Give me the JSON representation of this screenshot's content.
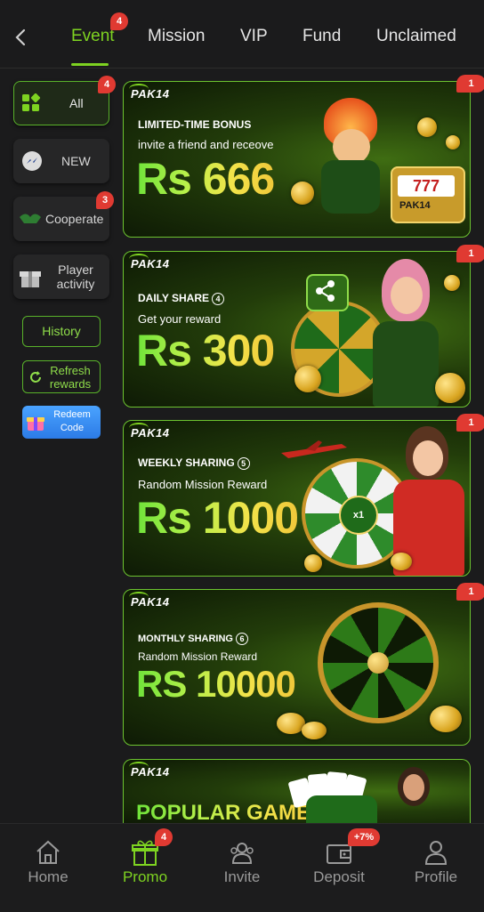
{
  "tabs": {
    "items": [
      {
        "label": "Event",
        "badge": "4"
      },
      {
        "label": "Mission"
      },
      {
        "label": "VIP"
      },
      {
        "label": "Fund"
      },
      {
        "label": "Unclaimed"
      }
    ]
  },
  "sidebar": {
    "all": {
      "label": "All",
      "badge": "4"
    },
    "new": {
      "label": "NEW"
    },
    "cooperate": {
      "label": "Cooperate",
      "badge": "3"
    },
    "player_activity": {
      "line1": "Player",
      "line2": "activity"
    },
    "history": {
      "label": "History"
    },
    "refresh": {
      "line1": "Refresh",
      "line2": "rewards"
    },
    "redeem": {
      "line1": "Redeem",
      "line2": "Code"
    }
  },
  "banners": [
    {
      "logo": "PAK14",
      "caption": "LIMITED-TIME BONUS",
      "subtitle": "invite a friend and receove",
      "amount": "Rs 666",
      "badge": "1"
    },
    {
      "logo": "PAK14",
      "caption": "DAILY SHARE",
      "caption_num": "4",
      "subtitle": "Get your reward",
      "amount": "Rs 300",
      "badge": "1"
    },
    {
      "logo": "PAK14",
      "caption": "WEEKLY SHARING",
      "caption_num": "5",
      "subtitle": "Random Mission Reward",
      "amount": "Rs 1000",
      "badge": "1",
      "wheel_text": "x1"
    },
    {
      "logo": "PAK14",
      "caption": "MONTHLY SHARING",
      "caption_num": "6",
      "subtitle": "Random Mission Reward",
      "amount": "RS 10000",
      "badge": "1"
    },
    {
      "logo": "PAK14",
      "title": "POPULAR GAMES"
    }
  ],
  "slot_text": "777",
  "brand_tag": "PAK14",
  "bottom_nav": {
    "home": {
      "label": "Home"
    },
    "promo": {
      "label": "Promo",
      "badge": "4"
    },
    "invite": {
      "label": "Invite"
    },
    "deposit": {
      "label": "Deposit",
      "badge": "+7%"
    },
    "profile": {
      "label": "Profile"
    }
  },
  "colors": {
    "accent": "#7ed321",
    "badge": "#e03a32",
    "background": "#1b1b1c"
  }
}
